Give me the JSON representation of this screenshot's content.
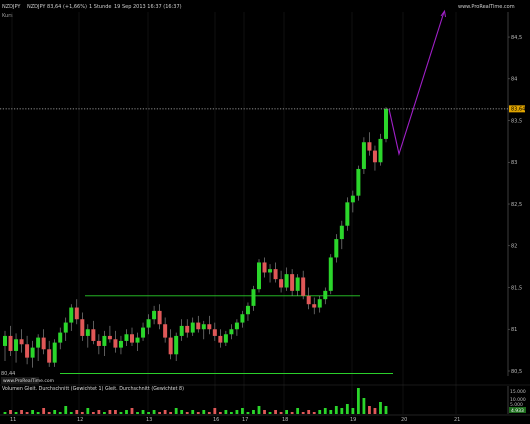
{
  "header": {
    "symbol": "NZDJPY",
    "quote": "NZDJPY 83,64 (+1,66%)",
    "timeframe": "1 Stunde",
    "datetime": "19 Sep 2013 16:37 (16:37)",
    "brand": "www.ProRealTime.com",
    "sub_label": "Kurs"
  },
  "price_axis": {
    "ticks": [
      "84,5",
      "84",
      "83,5",
      "83",
      "82,5",
      "82",
      "81,5",
      "81",
      "80,5"
    ],
    "current_price_label": "83,64"
  },
  "time_axis": {
    "labels": [
      "11",
      "12",
      "13",
      "16",
      "17",
      "18",
      "19",
      "20",
      "21"
    ]
  },
  "volume_panel": {
    "title": "Volumen Gleit. Durchschnitt (Gewichtet 1) Gleit. Durchschnitt (Gewichtet 8)",
    "ticks": [
      "15.000",
      "10.000",
      "5.000",
      "4.933"
    ],
    "low_price_label": "80,44"
  },
  "colors": {
    "up_candle": "#2bd62b",
    "down_candle": "#e05858",
    "projection": "#a020c8",
    "support_lines": "#2bcf2b",
    "current_price_line": "#bdbdbd"
  },
  "chart_data": {
    "type": "candlestick",
    "price_ylim": [
      80.44,
      84.8
    ],
    "x": [
      "11",
      "12",
      "13",
      "16",
      "17",
      "18",
      "19",
      "20",
      "21"
    ],
    "series": [
      {
        "values": [
          {
            "o": 80.8,
            "h": 80.98,
            "l": 80.62,
            "c": 80.92
          },
          {
            "o": 80.92,
            "h": 81.04,
            "l": 80.68,
            "c": 80.74
          },
          {
            "o": 80.74,
            "h": 80.95,
            "l": 80.6,
            "c": 80.88
          },
          {
            "o": 80.88,
            "h": 81.0,
            "l": 80.72,
            "c": 80.82
          },
          {
            "o": 80.82,
            "h": 80.92,
            "l": 80.58,
            "c": 80.66
          },
          {
            "o": 80.66,
            "h": 80.86,
            "l": 80.54,
            "c": 80.78
          },
          {
            "o": 80.78,
            "h": 80.94,
            "l": 80.62,
            "c": 80.9
          },
          {
            "o": 80.9,
            "h": 81.0,
            "l": 80.7,
            "c": 80.76
          },
          {
            "o": 80.76,
            "h": 80.86,
            "l": 80.55,
            "c": 80.6
          },
          {
            "o": 80.6,
            "h": 80.88,
            "l": 80.55,
            "c": 80.84
          },
          {
            "o": 80.84,
            "h": 81.02,
            "l": 80.76,
            "c": 80.96
          },
          {
            "o": 80.96,
            "h": 81.14,
            "l": 80.86,
            "c": 81.08
          },
          {
            "o": 81.08,
            "h": 81.3,
            "l": 80.98,
            "c": 81.26
          },
          {
            "o": 81.26,
            "h": 81.36,
            "l": 81.06,
            "c": 81.12
          },
          {
            "o": 81.12,
            "h": 81.2,
            "l": 80.86,
            "c": 80.92
          },
          {
            "o": 80.92,
            "h": 81.06,
            "l": 80.78,
            "c": 81.0
          },
          {
            "o": 81.0,
            "h": 81.1,
            "l": 80.82,
            "c": 80.86
          },
          {
            "o": 80.86,
            "h": 80.94,
            "l": 80.7,
            "c": 80.8
          },
          {
            "o": 80.8,
            "h": 80.98,
            "l": 80.68,
            "c": 80.92
          },
          {
            "o": 80.92,
            "h": 81.04,
            "l": 80.84,
            "c": 80.88
          },
          {
            "o": 80.88,
            "h": 80.98,
            "l": 80.72,
            "c": 80.78
          },
          {
            "o": 80.78,
            "h": 80.92,
            "l": 80.7,
            "c": 80.86
          },
          {
            "o": 80.86,
            "h": 81.0,
            "l": 80.8,
            "c": 80.94
          },
          {
            "o": 80.94,
            "h": 81.02,
            "l": 80.8,
            "c": 80.84
          },
          {
            "o": 80.84,
            "h": 80.96,
            "l": 80.74,
            "c": 80.9
          },
          {
            "o": 80.9,
            "h": 81.08,
            "l": 80.86,
            "c": 81.02
          },
          {
            "o": 81.02,
            "h": 81.18,
            "l": 80.94,
            "c": 81.12
          },
          {
            "o": 81.12,
            "h": 81.28,
            "l": 81.06,
            "c": 81.22
          },
          {
            "o": 81.22,
            "h": 81.3,
            "l": 81.0,
            "c": 81.06
          },
          {
            "o": 81.06,
            "h": 81.14,
            "l": 80.84,
            "c": 80.9
          },
          {
            "o": 80.9,
            "h": 81.0,
            "l": 80.64,
            "c": 80.7
          },
          {
            "o": 80.7,
            "h": 80.96,
            "l": 80.62,
            "c": 80.92
          },
          {
            "o": 80.92,
            "h": 81.12,
            "l": 80.86,
            "c": 81.04
          },
          {
            "o": 81.04,
            "h": 81.12,
            "l": 80.9,
            "c": 80.96
          },
          {
            "o": 80.96,
            "h": 81.14,
            "l": 80.92,
            "c": 81.08
          },
          {
            "o": 81.08,
            "h": 81.16,
            "l": 80.96,
            "c": 81.0
          },
          {
            "o": 81.0,
            "h": 81.1,
            "l": 80.88,
            "c": 81.06
          },
          {
            "o": 81.06,
            "h": 81.16,
            "l": 80.94,
            "c": 81.0
          },
          {
            "o": 81.0,
            "h": 81.08,
            "l": 80.86,
            "c": 80.92
          },
          {
            "o": 80.92,
            "h": 81.0,
            "l": 80.78,
            "c": 80.84
          },
          {
            "o": 80.84,
            "h": 80.98,
            "l": 80.8,
            "c": 80.94
          },
          {
            "o": 80.94,
            "h": 81.06,
            "l": 80.88,
            "c": 81.0
          },
          {
            "o": 81.0,
            "h": 81.12,
            "l": 80.92,
            "c": 81.08
          },
          {
            "o": 81.08,
            "h": 81.22,
            "l": 81.02,
            "c": 81.18
          },
          {
            "o": 81.18,
            "h": 81.32,
            "l": 81.1,
            "c": 81.28
          },
          {
            "o": 81.28,
            "h": 81.52,
            "l": 81.22,
            "c": 81.48
          },
          {
            "o": 81.48,
            "h": 81.84,
            "l": 81.44,
            "c": 81.8
          },
          {
            "o": 81.8,
            "h": 81.86,
            "l": 81.62,
            "c": 81.68
          },
          {
            "o": 81.68,
            "h": 81.78,
            "l": 81.56,
            "c": 81.72
          },
          {
            "o": 81.72,
            "h": 81.8,
            "l": 81.56,
            "c": 81.6
          },
          {
            "o": 81.6,
            "h": 81.7,
            "l": 81.44,
            "c": 81.5
          },
          {
            "o": 81.5,
            "h": 81.74,
            "l": 81.46,
            "c": 81.66
          },
          {
            "o": 81.66,
            "h": 81.72,
            "l": 81.4,
            "c": 81.46
          },
          {
            "o": 81.46,
            "h": 81.66,
            "l": 81.4,
            "c": 81.62
          },
          {
            "o": 81.62,
            "h": 81.7,
            "l": 81.36,
            "c": 81.4
          },
          {
            "o": 81.4,
            "h": 81.5,
            "l": 81.24,
            "c": 81.3
          },
          {
            "o": 81.3,
            "h": 81.38,
            "l": 81.18,
            "c": 81.26
          },
          {
            "o": 81.26,
            "h": 81.4,
            "l": 81.2,
            "c": 81.36
          },
          {
            "o": 81.36,
            "h": 81.5,
            "l": 81.3,
            "c": 81.46
          },
          {
            "o": 81.46,
            "h": 81.9,
            "l": 81.42,
            "c": 81.86
          },
          {
            "o": 81.86,
            "h": 82.14,
            "l": 81.8,
            "c": 82.08
          },
          {
            "o": 82.08,
            "h": 82.3,
            "l": 81.96,
            "c": 82.24
          },
          {
            "o": 82.24,
            "h": 82.58,
            "l": 82.18,
            "c": 82.52
          },
          {
            "o": 82.52,
            "h": 82.66,
            "l": 82.4,
            "c": 82.6
          },
          {
            "o": 82.6,
            "h": 82.96,
            "l": 82.54,
            "c": 82.92
          },
          {
            "o": 82.92,
            "h": 83.3,
            "l": 82.86,
            "c": 83.24
          },
          {
            "o": 83.24,
            "h": 83.36,
            "l": 83.08,
            "c": 83.14
          },
          {
            "o": 83.14,
            "h": 83.2,
            "l": 82.9,
            "c": 83.0
          },
          {
            "o": 83.0,
            "h": 83.34,
            "l": 82.96,
            "c": 83.28
          },
          {
            "o": 83.28,
            "h": 83.66,
            "l": 83.24,
            "c": 83.64
          }
        ]
      }
    ],
    "projection_path": [
      [
        83.64
      ],
      [
        83.1
      ],
      [
        84.8
      ]
    ],
    "support_lines": [
      81.4,
      80.47
    ],
    "volume_values": [
      1,
      2,
      1,
      2,
      1,
      2,
      1,
      3,
      1,
      2,
      1,
      4,
      1,
      2,
      1,
      3,
      1,
      2,
      1,
      2,
      2,
      1,
      2,
      3,
      1,
      2,
      1,
      2,
      1,
      2,
      1,
      3,
      2,
      1,
      2,
      1,
      2,
      1,
      3,
      1,
      2,
      1,
      2,
      3,
      1,
      2,
      4,
      2,
      1,
      2,
      1,
      2,
      1,
      3,
      1,
      2,
      1,
      2,
      3,
      2,
      4,
      3,
      5,
      3,
      13,
      8,
      4,
      3,
      6,
      4
    ]
  }
}
